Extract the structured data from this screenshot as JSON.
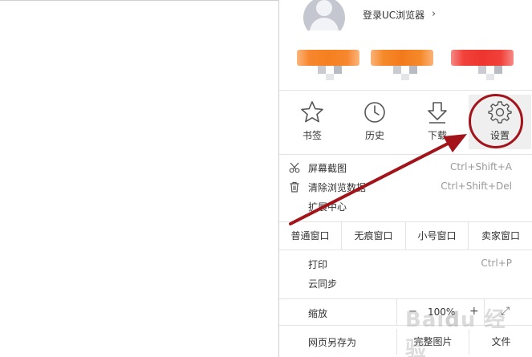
{
  "account": {
    "login_label": "登录UC浏览器",
    "chevron": "›"
  },
  "promos": [
    {
      "color": "#f7862e",
      "color2": "#fbb57b"
    },
    {
      "color": "#f58a2b",
      "color2": "#fab27a"
    },
    {
      "color": "#f1413a",
      "color2": "#f68a86"
    }
  ],
  "toolbar": {
    "bookmarks": {
      "label": "书签",
      "icon": "star-icon"
    },
    "history": {
      "label": "历史",
      "icon": "clock-icon"
    },
    "downloads": {
      "label": "下载",
      "icon": "download-icon"
    },
    "settings": {
      "label": "设置",
      "icon": "gear-icon"
    }
  },
  "items": {
    "screenshot": {
      "label": "屏幕截图",
      "shortcut": "Ctrl+Shift+A",
      "icon": "scissors-icon"
    },
    "clear_data": {
      "label": "清除浏览数据",
      "shortcut": "Ctrl+Shift+Del",
      "icon": "trash-icon"
    },
    "extensions": {
      "label": "扩展中心"
    }
  },
  "windows": {
    "normal": "普通窗口",
    "incognito": "无痕窗口",
    "small": "小号窗口",
    "seller": "卖家窗口"
  },
  "print": {
    "label": "打印",
    "shortcut": "Ctrl+P"
  },
  "cloud_sync": {
    "label": "云同步"
  },
  "zoom": {
    "label": "缩放",
    "minus": "−",
    "value": "100%",
    "plus": "+",
    "fullscreen": "⤢"
  },
  "save": {
    "label": "网页另存为",
    "complete": "完整图片",
    "file": "文件"
  },
  "watermark": "Baidu 经验",
  "colors": {
    "annotation": "#a3141a",
    "divider": "#e3e3e3",
    "active_bg": "#efefef"
  }
}
